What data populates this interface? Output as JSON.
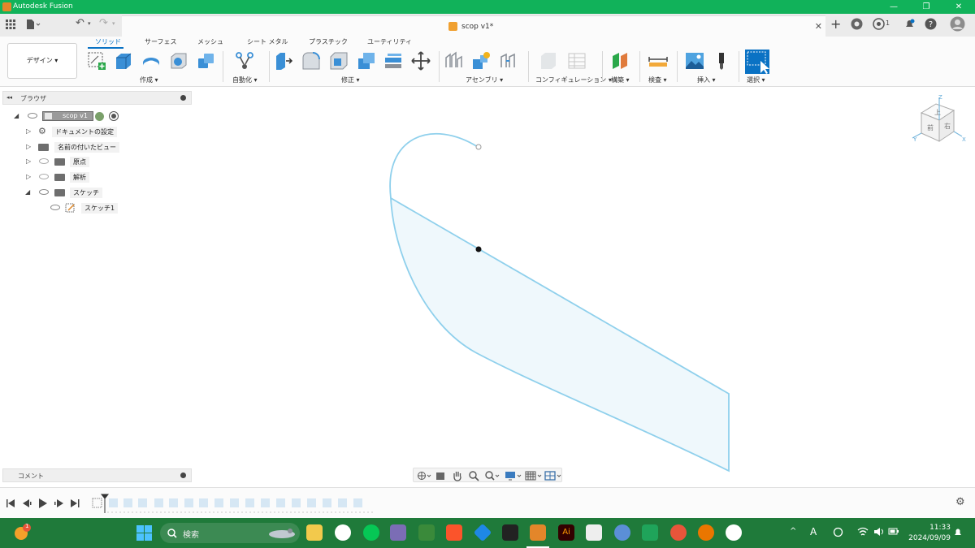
{
  "window": {
    "app_title": "Autodesk Fusion",
    "minimize_glyph": "—",
    "restore_glyph": "❐",
    "close_glyph": "✕"
  },
  "document_tab": {
    "title": "scop v1*",
    "close_glyph": "✕"
  },
  "quick_access": {
    "undo_glyph": "↶",
    "redo_glyph": "↷",
    "notification_count": "1"
  },
  "ribbon": {
    "workspace_label": "デザイン ▾",
    "tabs": [
      "ソリッド",
      "サーフェス",
      "メッシュ",
      "シート メタル",
      "プラスチック",
      "ユーティリティ"
    ],
    "groups": {
      "create": "作成 ▾",
      "automate": "自動化 ▾",
      "modify": "修正 ▾",
      "assemble": "アセンブリ ▾",
      "configure": "コンフィギュレーション ▾",
      "construct": "構築 ▾",
      "inspect": "検査 ▾",
      "insert": "挿入 ▾",
      "select": "選択 ▾"
    }
  },
  "browser": {
    "title": "ブラウザ",
    "root": "scop v1",
    "items": [
      {
        "label": "ドキュメントの設定"
      },
      {
        "label": "名前の付いたビュー"
      },
      {
        "label": "原点"
      },
      {
        "label": "解析"
      },
      {
        "label": "スケッチ"
      },
      {
        "label": "スケッチ1"
      }
    ]
  },
  "comments": {
    "title": "コメント"
  },
  "viewcube": {
    "axis_x": "X",
    "axis_y": "Y",
    "axis_z": "Z",
    "face_top": "上",
    "face_front": "前",
    "face_right": "右"
  },
  "taskbar": {
    "search_placeholder": "検索",
    "time": "11:33",
    "date": "2024/09/09",
    "badge_count": "1",
    "ime_label": "A"
  },
  "colors": {
    "titlebar": "#11b25a",
    "taskbar": "#1f7a3a",
    "accent": "#0a72c4",
    "sketch_line": "#8fd0ec",
    "sketch_fill": "#eff8fc"
  }
}
